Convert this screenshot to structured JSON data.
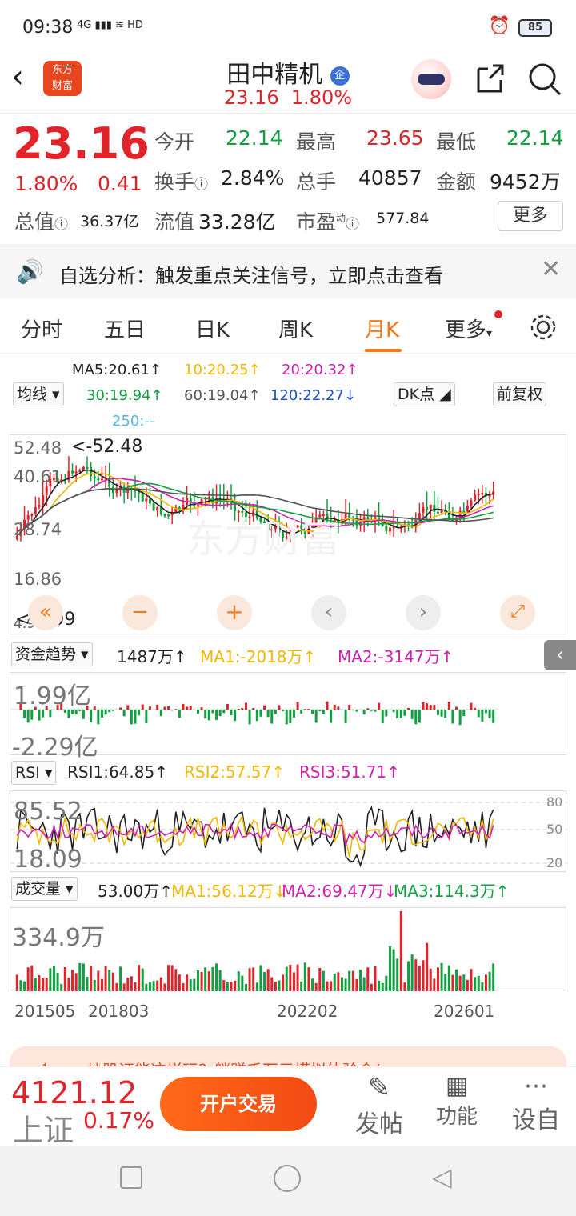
{
  "status": {
    "time": "09:38",
    "network": "4G",
    "hd": "HD",
    "battery": "85"
  },
  "header": {
    "logo_line1": "东方",
    "logo_line2": "财富",
    "title": "田中精机",
    "badge": "企",
    "price": "23.16",
    "change_pct": "1.80%"
  },
  "quote": {
    "price": "23.16",
    "change_pct": "1.80%",
    "change_amt": "0.41",
    "open_label": "今开",
    "open": "22.14",
    "high_label": "最高",
    "high": "23.65",
    "low_label": "最低",
    "low": "22.14",
    "turnover_label": "换手",
    "turnover": "2.84%",
    "volume_label": "总手",
    "volume": "40857",
    "amount_label": "金额",
    "amount": "9452万",
    "mktcap_label": "总值",
    "mktcap": "36.37亿",
    "float_label": "流值",
    "float": "33.28亿",
    "pe_label": "市盈",
    "pe_sup": "动",
    "pe": "577.84",
    "more_label": "更多"
  },
  "banner": {
    "text": "自选分析：触发重点关注信号，立即点击查看"
  },
  "tabs": [
    "分时",
    "五日",
    "日K",
    "周K",
    "月K",
    "更多"
  ],
  "ma": {
    "ma5": "MA5:20.61↑",
    "ma10": "10:20.25↑",
    "ma20": "20:20.32↑",
    "ma30": "30:19.94↑",
    "ma60": "60:19.04↑",
    "ma120": "120:22.27↓",
    "ma250": "250:--",
    "indicator": "均线",
    "dk": "DK点",
    "adjust": "前复权"
  },
  "kline": {
    "ymax": "52.48",
    "y2": "40.61",
    "y3": "28.74",
    "y4": "16.86",
    "ymin": "4.99",
    "max_note": "<-52.48",
    "min_note": "<-4.99",
    "watermark": "东方财富"
  },
  "fund": {
    "label": "资金趋势",
    "value": "1487万↑",
    "ma1": "MA1:-2018万↑",
    "ma2": "MA2:-3147万↑",
    "top": "1.99亿",
    "bottom": "-2.29亿"
  },
  "rsi": {
    "label": "RSI",
    "rsi1": "RSI1:64.85↑",
    "rsi2": "RSI2:57.57↑",
    "rsi3": "RSI3:51.71↑",
    "top": "85.52",
    "bottom": "18.09",
    "g80": "80",
    "g50": "50",
    "g20": "20"
  },
  "vol": {
    "label": "成交量",
    "value": "53.00万↑",
    "ma1": "MA1:56.12万↓",
    "ma2": "MA2:69.47万↓",
    "ma3": "MA3:114.3万↑",
    "top": "334.9万"
  },
  "xaxis": [
    "201505",
    "201803",
    "202202",
    "202601"
  ],
  "promo": {
    "text": "炒股证能这样玩？躺赚千万元模拟体验金！"
  },
  "bottom": {
    "index_value": "4121.12",
    "index_name": "上证",
    "index_pct": "0.17%",
    "trade": "开户交易",
    "post": "发帖",
    "func": "功能",
    "custom": "设自"
  },
  "colors": {
    "up": "#e0242a",
    "down": "#10a040",
    "accent": "#f27a1c",
    "ma_black": "#222222",
    "ma_yellow": "#f0b800",
    "ma_magenta": "#d020b0",
    "ma_green": "#10a040"
  }
}
